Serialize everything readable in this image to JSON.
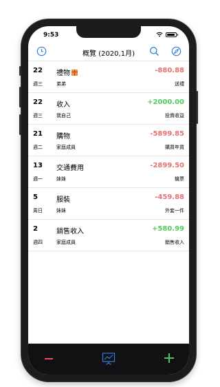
{
  "status": {
    "time": "9:53"
  },
  "nav": {
    "title": "概覽 (2020,1月)"
  },
  "entries": [
    {
      "day": "22",
      "weekday": "週三",
      "category": "禮物",
      "category_icon": "gift-icon",
      "person": "弟弟",
      "amount": "-880.88",
      "note": "送禮",
      "kind": "expense"
    },
    {
      "day": "22",
      "weekday": "週三",
      "category": "收入",
      "person": "我自己",
      "amount": "+2000.00",
      "note": "投資收益",
      "kind": "income"
    },
    {
      "day": "21",
      "weekday": "週二",
      "category": "購物",
      "person": "家庭成員",
      "amount": "-5899.85",
      "note": "購買年貨",
      "kind": "expense"
    },
    {
      "day": "13",
      "weekday": "週一",
      "category": "交通費用",
      "person": "妹妹",
      "amount": "-2899.50",
      "note": "機票",
      "kind": "expense"
    },
    {
      "day": "5",
      "weekday": "周日",
      "category": "服裝",
      "person": "妹妹",
      "amount": "-459.88",
      "note": "外套一件",
      "kind": "expense"
    },
    {
      "day": "2",
      "weekday": "週四",
      "category": "銷售收入",
      "person": "家庭成員",
      "amount": "+580.99",
      "note": "銷售收入",
      "kind": "income"
    }
  ],
  "colors": {
    "expense": "#e57070",
    "income": "#4fcb5d",
    "accent": "#2f7fd6",
    "toolbar": "#111114"
  }
}
